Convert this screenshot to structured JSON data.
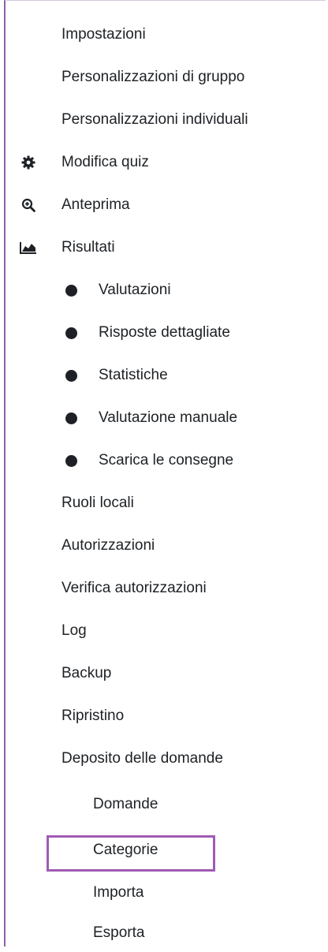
{
  "menu": {
    "settings": "Impostazioni",
    "group_overrides": "Personalizzazioni di gruppo",
    "user_overrides": "Personalizzazioni individuali",
    "edit_quiz": "Modifica quiz",
    "preview": "Anteprima",
    "results": "Risultati",
    "results_items": [
      "Valutazioni",
      "Risposte dettagliate",
      "Statistiche",
      "Valutazione manuale",
      "Scarica le consegne"
    ],
    "local_roles": "Ruoli locali",
    "permissions": "Autorizzazioni",
    "check_permissions": "Verifica autorizzazioni",
    "logs": "Log",
    "backup": "Backup",
    "restore": "Ripristino",
    "question_bank": "Deposito delle domande",
    "question_bank_items": [
      "Domande",
      "Categorie",
      "Importa",
      "Esporta"
    ]
  },
  "icons": {
    "edit_quiz": "gear-icon",
    "preview": "zoom-in-icon",
    "results": "area-chart-icon"
  },
  "colors": {
    "highlight": "#a05bb4",
    "text": "#1d2125"
  }
}
